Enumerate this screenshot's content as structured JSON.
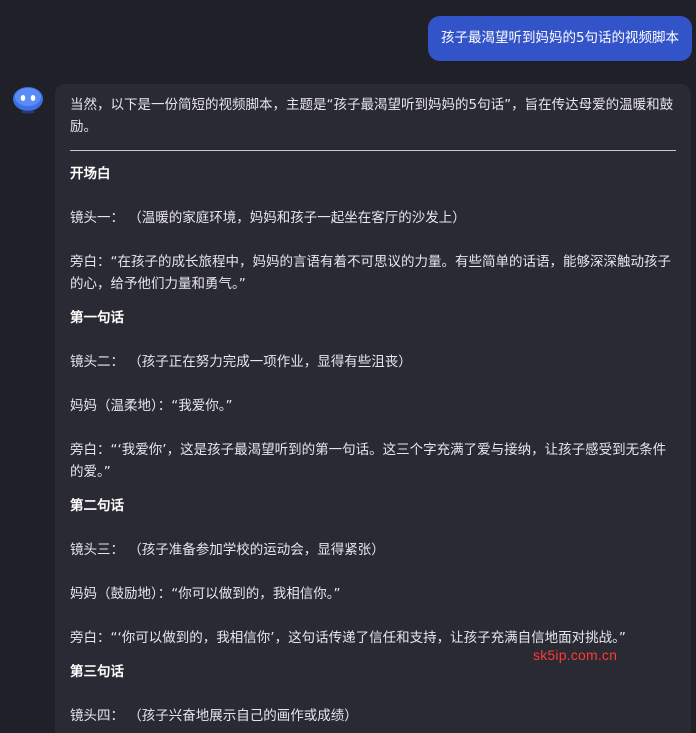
{
  "user_message": "孩子最渴望听到妈妈的5句话的视频脚本",
  "assistant": {
    "intro": "当然，以下是一份简短的视频脚本，主题是“孩子最渴望听到妈妈的5句话”，旨在传达母爱的温暖和鼓励。",
    "sections": [
      {
        "heading": "开场白",
        "lines": [
          "镜头一： （温暖的家庭环境，妈妈和孩子一起坐在客厅的沙发上）",
          "旁白：“在孩子的成长旅程中，妈妈的言语有着不可思议的力量。有些简单的话语，能够深深触动孩子的心，给予他们力量和勇气。”"
        ]
      },
      {
        "heading": "第一句话",
        "lines": [
          "镜头二： （孩子正在努力完成一项作业，显得有些沮丧）",
          "妈妈（温柔地）：“我爱你。”",
          "旁白：“‘我爱你’，这是孩子最渴望听到的第一句话。这三个字充满了爱与接纳，让孩子感受到无条件的爱。”"
        ]
      },
      {
        "heading": "第二句话",
        "lines": [
          "镜头三： （孩子准备参加学校的运动会，显得紧张）",
          "妈妈（鼓励地）：“你可以做到的，我相信你。”",
          "旁白：“‘你可以做到的，我相信你’，这句话传递了信任和支持，让孩子充满自信地面对挑战。”"
        ]
      },
      {
        "heading": "第三句话",
        "lines": [
          "镜头四： （孩子兴奋地展示自己的画作或成绩）"
        ]
      }
    ]
  },
  "watermark": "sk5ip.com.cn",
  "colors": {
    "background": "#1f2028",
    "user_bubble": "#3353c9",
    "assistant_card": "#2a2a34",
    "watermark": "#ff3b30"
  }
}
